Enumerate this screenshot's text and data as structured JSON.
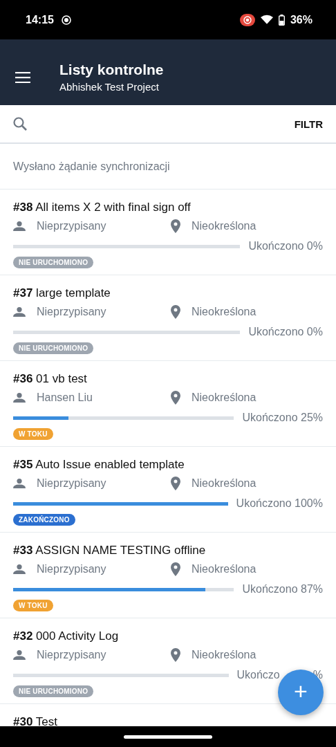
{
  "status_bar": {
    "time": "14:15",
    "battery": "36%"
  },
  "header": {
    "title": "Listy kontrolne",
    "subtitle": "Abhishek Test Project"
  },
  "search": {
    "filter_label": "FILTR"
  },
  "sync_message": "Wysłano żądanie synchronizacji",
  "checklists": [
    {
      "title": "**#38** All items X 2 with final sign off",
      "assignee": "Nieprzypisany",
      "location": "Nieokreślona",
      "level": 0,
      "reading": "Ukończono 0%",
      "status": {
        "kind": "not_started",
        "label": "NIE URUCHOMIONO"
      }
    },
    {
      "title": "**#37** large template",
      "assignee": "Nieprzypisany",
      "location": "Nieokreślona",
      "level": 0,
      "reading": "Ukończono 0%",
      "status": {
        "kind": "not_started",
        "label": "NIE URUCHOMIONO"
      }
    },
    {
      "title": "**#36** 01 vb test",
      "assignee": "Hansen Liu",
      "location": "Nieokreślona",
      "level": 0.25,
      "reading": "Ukończono 25%",
      "status": {
        "kind": "in_progress",
        "label": "W TOKU"
      }
    },
    {
      "title": "**#35** Auto Issue enabled template",
      "assignee": "Nieprzypisany",
      "location": "Nieokreślona",
      "level": 1,
      "reading": "Ukończono 100%",
      "status": {
        "kind": "completed",
        "label": "ZAKOŃCZONO"
      }
    },
    {
      "title": "**#33** ASSIGN NAME TESTING offline",
      "assignee": "Nieprzypisany",
      "location": "Nieokreślona",
      "level": 0.87,
      "reading": "Ukończono 87%",
      "status": {
        "kind": "in_progress",
        "label": "W TOKU"
      }
    },
    {
      "title": "**#32** 000 Activity Log",
      "assignee": "Nieprzypisany",
      "location": "Nieokreślona",
      "level": 0,
      "reading": "Ukończo",
      "reading_end": "%",
      "status": {
        "kind": "not_started",
        "label": "NIE URUCHOMIONO"
      }
    },
    {
      "title": "**#30** Test"
    }
  ],
  "fab": {
    "label": "+"
  }
}
